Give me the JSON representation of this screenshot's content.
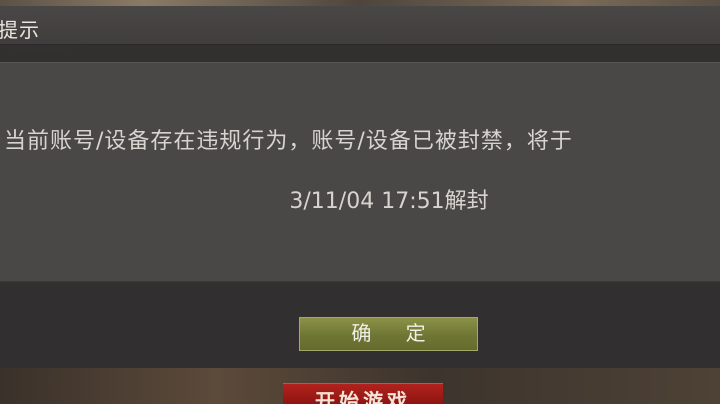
{
  "dialog": {
    "title": "提示",
    "message_line1": "当前账号/设备存在违规行为，账号/设备已被封禁，将于",
    "message_line2": "3/11/04 17:51解封",
    "confirm_label": "确 定"
  },
  "background": {
    "start_game_label": "开始游戏"
  },
  "colors": {
    "dialog_bg": "#322f30",
    "panel_bg": "#4a4747",
    "text": "#d7d4cf",
    "confirm_accent": "#767c38",
    "start_accent": "#a11c18"
  }
}
